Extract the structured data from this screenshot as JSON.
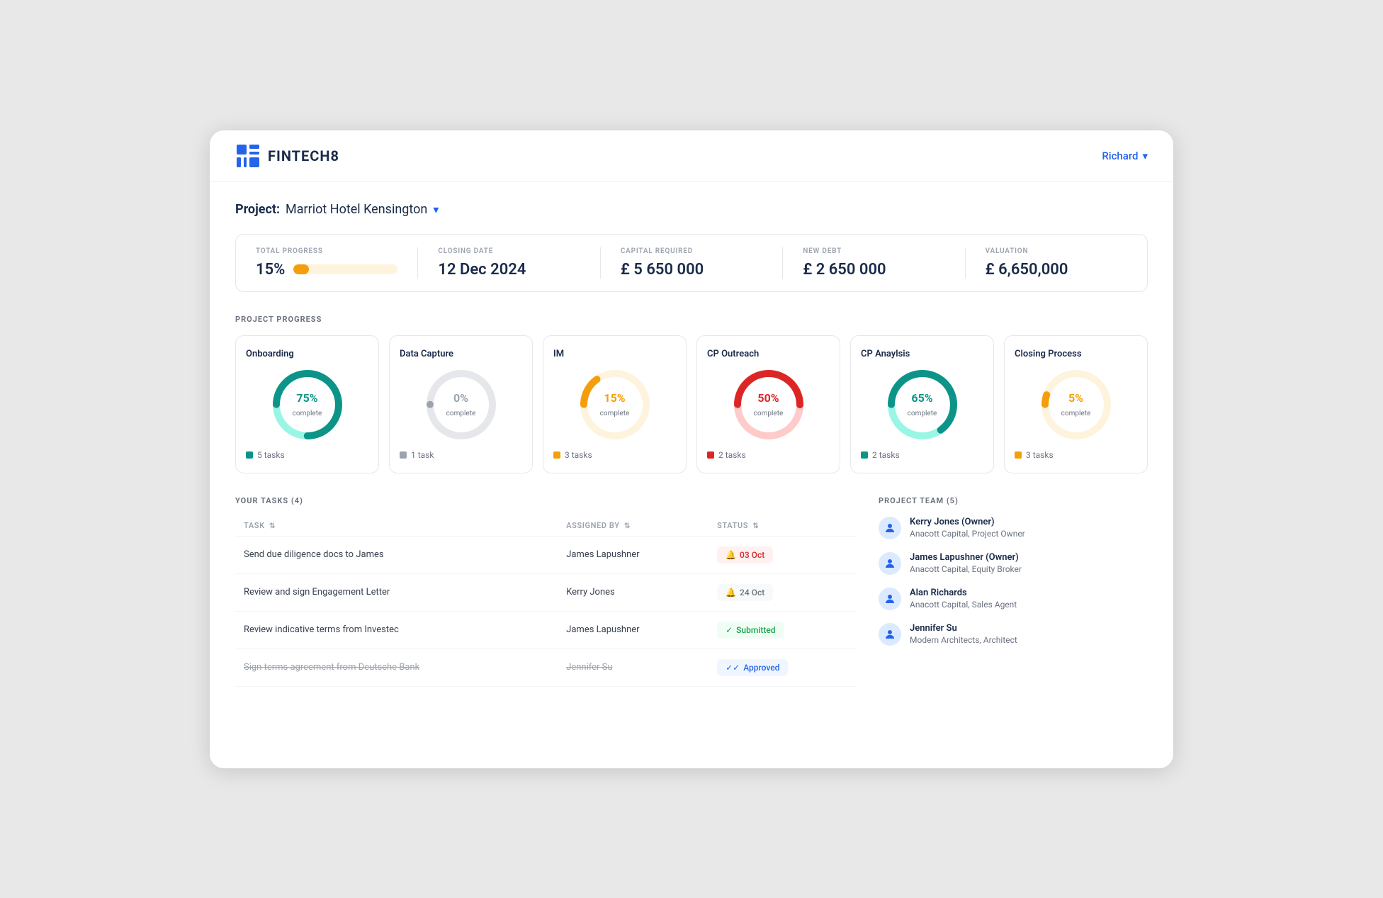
{
  "header": {
    "logo_text": "FINTECH8",
    "user_name": "Richard"
  },
  "project": {
    "label": "Project:",
    "name": "Marriot Hotel Kensington"
  },
  "stats": {
    "total_progress_label": "TOTAL PROGRESS",
    "total_progress_pct": "15%",
    "total_progress_value": 15,
    "closing_date_label": "CLOSING DATE",
    "closing_date_value": "12 Dec 2024",
    "capital_required_label": "CAPITAL REQUIRED",
    "capital_required_value": "£ 5 650 000",
    "new_debt_label": "NEW DEBT",
    "new_debt_value": "£ 2 650 000",
    "valuation_label": "VALUATION",
    "valuation_value": "£ 6,650,000"
  },
  "project_progress_title": "PROJECT PROGRESS",
  "progress_cards": [
    {
      "title": "Onboarding",
      "pct": 75,
      "pct_label": "75%",
      "pct_color": "#0d9488",
      "tasks": "5 tasks",
      "task_color": "#0d9488",
      "track_color": "#99f6e4",
      "bg_color": "#e5f9f6"
    },
    {
      "title": "Data Capture",
      "pct": 0,
      "pct_label": "0%",
      "pct_color": "#9ca3af",
      "tasks": "1 task",
      "task_color": "#9ca3af",
      "track_color": "#e5e7eb",
      "bg_color": "#f3f4f6"
    },
    {
      "title": "IM",
      "pct": 15,
      "pct_label": "15%",
      "pct_color": "#f59e0b",
      "tasks": "3 tasks",
      "task_color": "#f59e0b",
      "track_color": "#fef3dc",
      "bg_color": "#fffbeb"
    },
    {
      "title": "CP Outreach",
      "pct": 50,
      "pct_label": "50%",
      "pct_color": "#dc2626",
      "tasks": "2 tasks",
      "task_color": "#dc2626",
      "track_color": "#fecaca",
      "bg_color": "#fef2f2"
    },
    {
      "title": "CP Anaylsis",
      "pct": 65,
      "pct_label": "65%",
      "pct_color": "#0d9488",
      "tasks": "2 tasks",
      "task_color": "#0d9488",
      "track_color": "#99f6e4",
      "bg_color": "#e5f9f6"
    },
    {
      "title": "Closing Process",
      "pct": 5,
      "pct_label": "5%",
      "pct_color": "#f59e0b",
      "tasks": "3 tasks",
      "task_color": "#f59e0b",
      "track_color": "#fef3dc",
      "bg_color": "#fffbeb"
    }
  ],
  "tasks_section": {
    "title": "YOUR TASKS (4)",
    "columns": {
      "task": "TASK",
      "assigned_by": "ASSIGNED BY",
      "status": "STATUS"
    },
    "rows": [
      {
        "task": "Send due diligence docs to James",
        "assigned_by": "James Lapushner",
        "status_type": "overdue",
        "status_icon": "bell",
        "status_text": "03 Oct",
        "strikethrough": false
      },
      {
        "task": "Review and sign Engagement Letter",
        "assigned_by": "Kerry Jones",
        "status_type": "pending",
        "status_icon": "bell",
        "status_text": "24 Oct",
        "strikethrough": false
      },
      {
        "task": "Review indicative terms from Investec",
        "assigned_by": "James Lapushner",
        "status_type": "submitted",
        "status_icon": "check",
        "status_text": "Submitted",
        "strikethrough": false
      },
      {
        "task": "Sign terms agreement from Deutsche Bank",
        "assigned_by": "Jennifer Su",
        "status_type": "approved",
        "status_icon": "double-check",
        "status_text": "Approved",
        "strikethrough": true
      }
    ]
  },
  "team_section": {
    "title": "PROJECT TEAM (5)",
    "members": [
      {
        "name": "Kerry Jones (Owner)",
        "role": "Anacott Capital, Project Owner"
      },
      {
        "name": "James Lapushner (Owner)",
        "role": "Anacott Capital, Equity Broker"
      },
      {
        "name": "Alan Richards",
        "role": "Anacott Capital, Sales Agent"
      },
      {
        "name": "Jennifer Su",
        "role": "Modern Architects, Architect"
      }
    ]
  }
}
